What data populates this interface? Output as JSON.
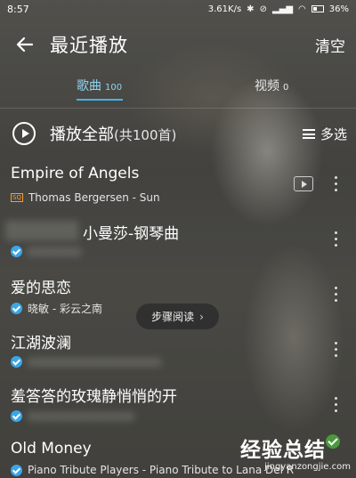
{
  "status_bar": {
    "time": "8:57",
    "network_speed": "3.61K/s",
    "battery": "36%",
    "icons": [
      "bluetooth-icon",
      "alarm-off-icon",
      "signal-icon",
      "wifi-icon",
      "battery-icon"
    ]
  },
  "header": {
    "title": "最近播放",
    "clear_label": "清空"
  },
  "tabs": [
    {
      "label": "歌曲",
      "count": "100",
      "active": true
    },
    {
      "label": "视频",
      "count": "0",
      "active": false
    }
  ],
  "play_all": {
    "label": "播放全部",
    "count_text": "(共100首)",
    "multi_select_label": "多选"
  },
  "songs": [
    {
      "title": "Empire of Angels",
      "subtitle": "Thomas Bergersen - Sun",
      "badge": "SQ",
      "has_mv": true
    },
    {
      "title": "小曼莎-钢琴曲",
      "subtitle": "",
      "badge": "",
      "has_mv": false
    },
    {
      "title": "爱的思恋",
      "subtitle": "晓敏 - 彩云之南",
      "badge": "",
      "has_mv": false
    },
    {
      "title": "江湖波澜",
      "subtitle": "",
      "badge": "",
      "has_mv": false
    },
    {
      "title": "羞答答的玫瑰静悄悄的开",
      "subtitle": "",
      "badge": "",
      "has_mv": false
    },
    {
      "title": "Old Money",
      "subtitle": "Piano Tribute Players - Piano Tribute to Lana Del R",
      "badge": "",
      "has_mv": false
    }
  ],
  "overlay": {
    "step_read_label": "步骤阅读",
    "chevron": "›"
  },
  "watermark": {
    "title": "经验总结",
    "url": "jingyanzongjie.com"
  },
  "colors": {
    "accent": "#3bb6ef",
    "active_tab": "#8fd3f0",
    "check_badge": "#3aa6e6",
    "sq_badge": "#ff9d2a"
  }
}
